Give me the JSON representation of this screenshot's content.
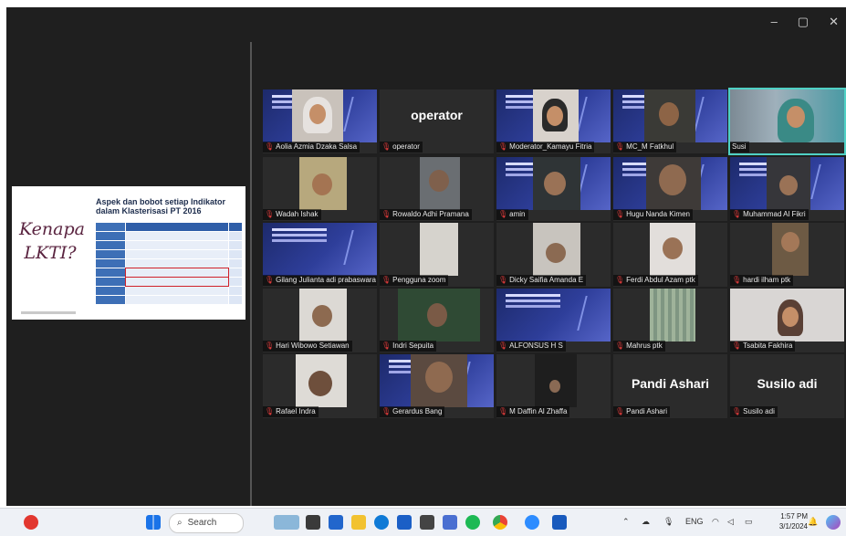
{
  "window": {
    "controls": [
      "–",
      "▢",
      "✕"
    ]
  },
  "slide": {
    "left_title": "Kenapa LKTI?",
    "title": "Aspek dan bobot setiap Indikator dalam Klasterisasi PT 2016"
  },
  "tiles": [
    {
      "name": "Aolia Azmia Dzaka Salsa"
    },
    {
      "name": "operator",
      "big": "operator"
    },
    {
      "name": "Moderator_Kamayu Fitria"
    },
    {
      "name": "MC_M Fatkhul"
    },
    {
      "name": "Susi"
    },
    {
      "name": "Wadah Ishak"
    },
    {
      "name": "Rowaldo Adhi Pramana"
    },
    {
      "name": "amin"
    },
    {
      "name": "Hugu Nanda Kimen"
    },
    {
      "name": "Muhammad Al Fikri"
    },
    {
      "name": "Gilang Julianta adi prabaswara"
    },
    {
      "name": "Pengguna zoom"
    },
    {
      "name": "Dicky Saifia Amanda E"
    },
    {
      "name": "Ferdi Abdul Azam ptk"
    },
    {
      "name": "hardi ilham ptk"
    },
    {
      "name": "Hari Wibowo Setiawan"
    },
    {
      "name": "Indri Sepuita"
    },
    {
      "name": "ALFONSUS H S"
    },
    {
      "name": "Mahrus ptk"
    },
    {
      "name": "Tsabita Fakhira"
    },
    {
      "name": "Rafael Indra"
    },
    {
      "name": "Gerardus Bang"
    },
    {
      "name": "M Daffin Al Zhaffa"
    },
    {
      "name": "Pandi Ashari",
      "big": "Pandi Ashari"
    },
    {
      "name": "Susilo adi",
      "big": "Susilo adi"
    }
  ],
  "taskbar": {
    "search_label": "Search",
    "language": "ENG",
    "time": "1:57 PM",
    "date": "3/1/2024"
  }
}
